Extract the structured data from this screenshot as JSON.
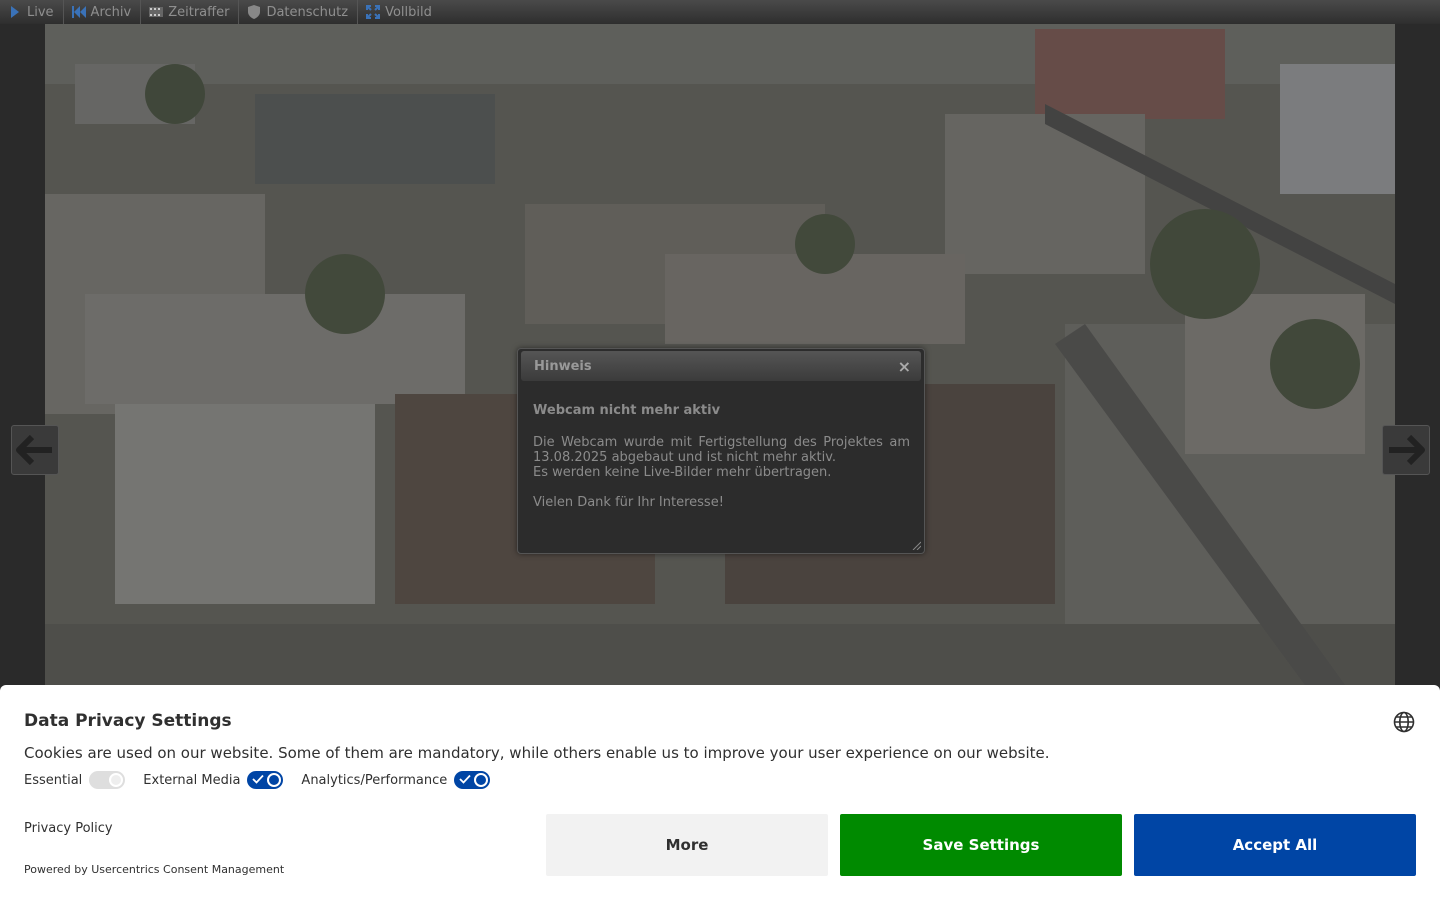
{
  "nav": {
    "items": [
      {
        "label": "Live",
        "icon": "play-icon"
      },
      {
        "label": "Archiv",
        "icon": "rewind-icon"
      },
      {
        "label": "Zeitraffer",
        "icon": "filmstrip-icon"
      },
      {
        "label": "Datenschutz",
        "icon": "shield-icon"
      },
      {
        "label": "Vollbild",
        "icon": "fullscreen-icon"
      }
    ]
  },
  "dialog": {
    "title": "Hinweis",
    "close": "×",
    "heading": "Webcam nicht mehr aktiv",
    "line1": "Die Webcam wurde mit Fertigstellung des Projektes am 13.08.2025 abgebaut und ist nicht mehr aktiv.",
    "line2": "Es werden keine Live-Bilder mehr übertragen.",
    "line3": "Vielen Dank für Ihr Interesse!"
  },
  "consent": {
    "title": "Data Privacy Settings",
    "description": "Cookies are used on our website. Some of them are mandatory, while others enable us to improve your user experience on our website.",
    "toggles": [
      {
        "label": "Essential",
        "state": "on-disabled"
      },
      {
        "label": "External Media",
        "state": "on"
      },
      {
        "label": "Analytics/Performance",
        "state": "on"
      }
    ],
    "privacy_link": "Privacy Policy",
    "powered_by": "Powered by Usercentrics Consent Management",
    "buttons": {
      "more": "More",
      "save": "Save Settings",
      "accept": "Accept All"
    }
  },
  "colors": {
    "save": "#008a00",
    "accept": "#0045a5",
    "toggle_on": "#0045a5"
  }
}
